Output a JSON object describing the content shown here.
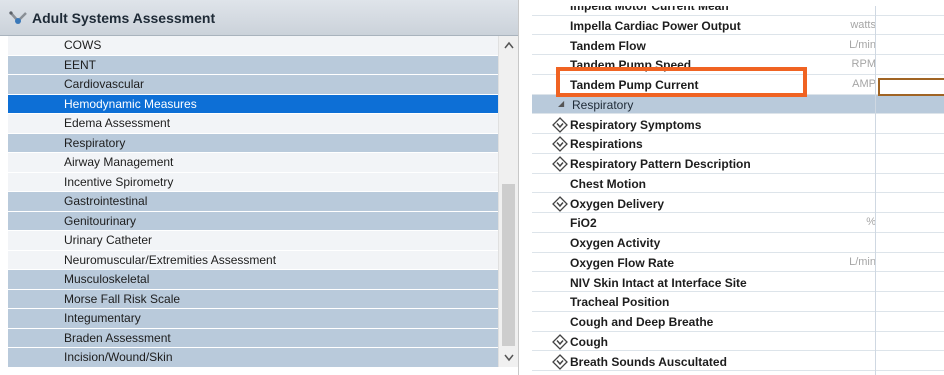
{
  "left_panel": {
    "title": "Adult Systems Assessment",
    "title_icon": "stethoscope-icon",
    "items": [
      {
        "label": "COWS",
        "style": "plain"
      },
      {
        "label": "EENT",
        "style": "shade"
      },
      {
        "label": "Cardiovascular",
        "style": "shade"
      },
      {
        "label": "Hemodynamic Measures",
        "style": "selected"
      },
      {
        "label": "Edema Assessment",
        "style": "plain"
      },
      {
        "label": "Respiratory",
        "style": "shade"
      },
      {
        "label": "Airway Management",
        "style": "plain"
      },
      {
        "label": "Incentive Spirometry",
        "style": "plain"
      },
      {
        "label": "Gastrointestinal",
        "style": "shade"
      },
      {
        "label": "Genitourinary",
        "style": "shade"
      },
      {
        "label": "Urinary Catheter",
        "style": "plain"
      },
      {
        "label": "Neuromuscular/Extremities Assessment",
        "style": "plain"
      },
      {
        "label": "Musculoskeletal",
        "style": "shade"
      },
      {
        "label": "Morse Fall Risk Scale",
        "style": "shade"
      },
      {
        "label": "Integumentary",
        "style": "shade"
      },
      {
        "label": "Braden Assessment",
        "style": "shade"
      },
      {
        "label": "Incision/Wound/Skin",
        "style": "shade"
      }
    ]
  },
  "right_panel": {
    "rows": [
      {
        "label": "Impella Motor Current Mean",
        "unit": "",
        "kind": "bold-cut"
      },
      {
        "label": "Impella Cardiac Power Output",
        "unit": "watts",
        "kind": "bold"
      },
      {
        "label": "Tandem Flow",
        "unit": "L/min",
        "kind": "bold"
      },
      {
        "label": "Tandem Pump Speed",
        "unit": "RPM",
        "kind": "bold"
      },
      {
        "label": "Tandem Pump Current",
        "unit": "AMP",
        "kind": "bold"
      },
      {
        "label": "Respiratory",
        "unit": "",
        "kind": "section"
      },
      {
        "label": "Respiratory Symptoms",
        "unit": "",
        "kind": "expand"
      },
      {
        "label": "Respirations",
        "unit": "",
        "kind": "expand"
      },
      {
        "label": "Respiratory Pattern Description",
        "unit": "",
        "kind": "expand"
      },
      {
        "label": "Chest Motion",
        "unit": "",
        "kind": "bold"
      },
      {
        "label": "Oxygen Delivery",
        "unit": "",
        "kind": "expand"
      },
      {
        "label": "FiO2",
        "unit": "%",
        "kind": "bold"
      },
      {
        "label": "Oxygen Activity",
        "unit": "",
        "kind": "bold"
      },
      {
        "label": "Oxygen Flow Rate",
        "unit": "L/min",
        "kind": "bold"
      },
      {
        "label": "NIV Skin Intact at Interface Site",
        "unit": "",
        "kind": "bold"
      },
      {
        "label": "Tracheal Position",
        "unit": "",
        "kind": "bold"
      },
      {
        "label": "Cough and Deep Breathe",
        "unit": "",
        "kind": "bold"
      },
      {
        "label": "Cough",
        "unit": "",
        "kind": "expand"
      },
      {
        "label": "Breath Sounds Auscultated",
        "unit": "",
        "kind": "expand"
      }
    ],
    "highlight_color": "#f06322"
  }
}
